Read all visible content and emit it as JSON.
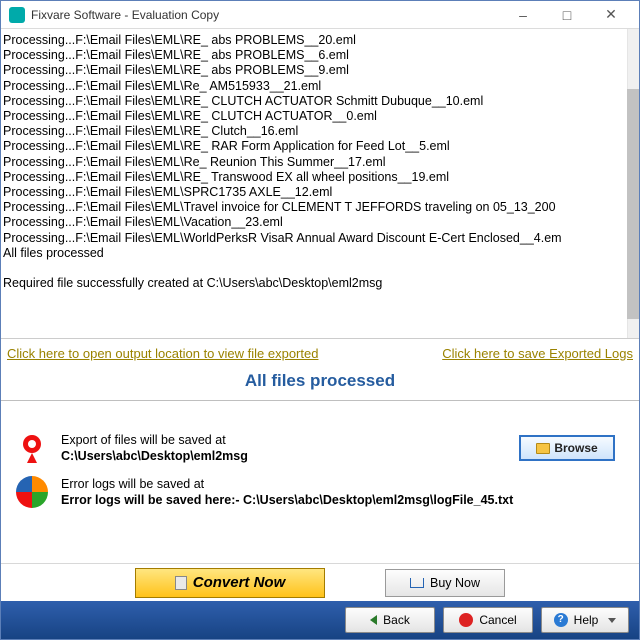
{
  "window": {
    "title": "Fixvare Software - Evaluation Copy"
  },
  "log_lines": [
    "Processing...F:\\Email Files\\EML\\RE_ abs PROBLEMS__20.eml",
    "Processing...F:\\Email Files\\EML\\RE_ abs PROBLEMS__6.eml",
    "Processing...F:\\Email Files\\EML\\RE_ abs PROBLEMS__9.eml",
    "Processing...F:\\Email Files\\EML\\Re_ AM515933__21.eml",
    "Processing...F:\\Email Files\\EML\\RE_ CLUTCH ACTUATOR Schmitt Dubuque__10.eml",
    "Processing...F:\\Email Files\\EML\\RE_ CLUTCH ACTUATOR__0.eml",
    "Processing...F:\\Email Files\\EML\\RE_ Clutch__16.eml",
    "Processing...F:\\Email Files\\EML\\RE_ RAR Form Application for Feed Lot__5.eml",
    "Processing...F:\\Email Files\\EML\\Re_ Reunion This Summer__17.eml",
    "Processing...F:\\Email Files\\EML\\RE_ Transwood EX all wheel positions__19.eml",
    "Processing...F:\\Email Files\\EML\\SPRC1735 AXLE__12.eml",
    "Processing...F:\\Email Files\\EML\\Travel invoice for CLEMENT T JEFFORDS traveling on 05_13_200",
    "Processing...F:\\Email Files\\EML\\Vacation__23.eml",
    "Processing...F:\\Email Files\\EML\\WorldPerksR VisaR Annual Award Discount E-Cert Enclosed__4.em",
    "All files processed",
    "",
    "Required file successfully created at C:\\Users\\abc\\Desktop\\eml2msg"
  ],
  "links": {
    "open_output": "Click here to open output location to view file exported",
    "save_logs": "Click here to save Exported Logs"
  },
  "status_text": "All files processed",
  "export_panel": {
    "heading": "Export of files will be saved at",
    "path": "C:\\Users\\abc\\Desktop\\eml2msg",
    "browse_label": "Browse"
  },
  "error_panel": {
    "heading": "Error logs will be saved at",
    "detail": "Error logs will be saved here:- C:\\Users\\abc\\Desktop\\eml2msg\\logFile_45.txt"
  },
  "actions": {
    "convert": "Convert Now",
    "buy": "Buy Now",
    "back": "Back",
    "cancel": "Cancel",
    "help": "Help"
  }
}
